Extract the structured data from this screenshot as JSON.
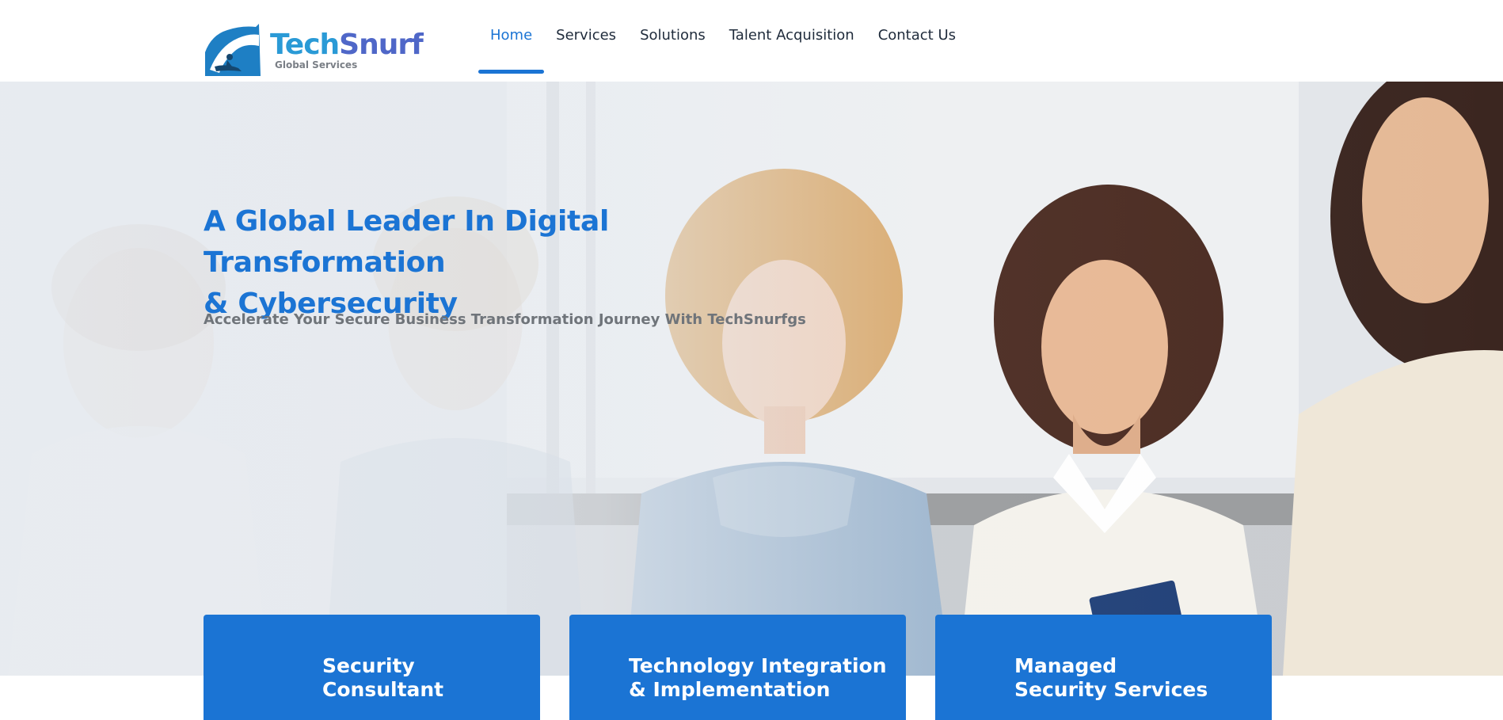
{
  "brand": {
    "name_part1": "Tech",
    "name_part2": "Snurf",
    "tagline": "Global Services"
  },
  "nav": {
    "items": [
      {
        "label": "Home",
        "active": true
      },
      {
        "label": "Services",
        "active": false
      },
      {
        "label": "Solutions",
        "active": false
      },
      {
        "label": "Talent Acquisition",
        "active": false
      },
      {
        "label": "Contact Us",
        "active": false
      }
    ]
  },
  "hero": {
    "title_line1": "A Global Leader In Digital Transformation",
    "title_line2": "& Cybersecurity",
    "subtitle": "Accelerate Your Secure Business Transformation Journey With TechSnurfgs"
  },
  "cards": [
    {
      "line1": "Security",
      "line2": "Consultant"
    },
    {
      "line1": "Technology Integration",
      "line2": "& Implementation"
    },
    {
      "line1": "Managed",
      "line2": "Security Services"
    }
  ],
  "colors": {
    "accent": "#1b74d4",
    "logo_light": "#2a9ad6",
    "logo_dark": "#4f67c8",
    "text": "#1f2b3b",
    "subtitle": "#6f747a"
  }
}
